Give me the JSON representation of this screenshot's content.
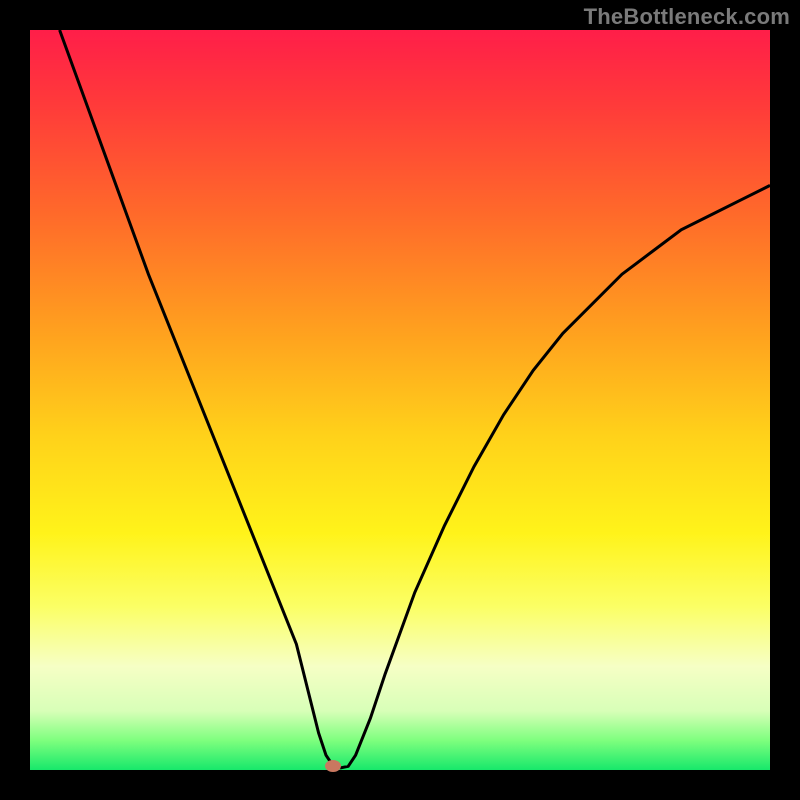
{
  "attribution": "TheBottleneck.com",
  "colors": {
    "page_bg": "#000000",
    "attribution_text": "#7a7a7a",
    "curve_stroke": "#000000",
    "marker_fill": "#c97860",
    "gradient_stops": [
      {
        "pos": 0.0,
        "hex": "#ff1e49"
      },
      {
        "pos": 0.1,
        "hex": "#ff3a3a"
      },
      {
        "pos": 0.25,
        "hex": "#ff6a2a"
      },
      {
        "pos": 0.4,
        "hex": "#ff9e1f"
      },
      {
        "pos": 0.55,
        "hex": "#ffd21a"
      },
      {
        "pos": 0.68,
        "hex": "#fff31a"
      },
      {
        "pos": 0.78,
        "hex": "#fbff66"
      },
      {
        "pos": 0.86,
        "hex": "#f6ffc5"
      },
      {
        "pos": 0.92,
        "hex": "#d8ffb8"
      },
      {
        "pos": 0.96,
        "hex": "#7eff7e"
      },
      {
        "pos": 1.0,
        "hex": "#17e86b"
      }
    ]
  },
  "chart_data": {
    "type": "line",
    "title": "",
    "xlabel": "",
    "ylabel": "",
    "xlim": [
      0,
      100
    ],
    "ylim": [
      0,
      100
    ],
    "x": [
      4,
      8,
      12,
      16,
      20,
      24,
      28,
      32,
      36,
      37,
      38,
      39,
      40,
      41,
      42,
      43,
      44,
      46,
      48,
      52,
      56,
      60,
      64,
      68,
      72,
      76,
      80,
      84,
      88,
      92,
      96,
      100
    ],
    "values": [
      100,
      89,
      78,
      67,
      57,
      47,
      37,
      27,
      17,
      13,
      9,
      5,
      2,
      0.5,
      0.3,
      0.5,
      2,
      7,
      13,
      24,
      33,
      41,
      48,
      54,
      59,
      63,
      67,
      70,
      73,
      75,
      77,
      79
    ],
    "minimum_marker": {
      "x": 41,
      "y": 0.5
    }
  }
}
